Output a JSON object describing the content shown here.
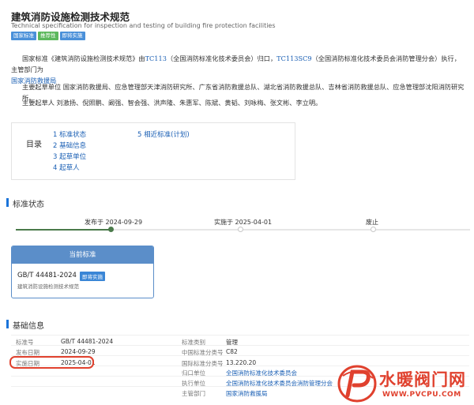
{
  "header": {
    "title": "建筑消防设施检测技术规范",
    "subtitle": "Technical specification for inspection and testing of building fire protection facilities",
    "badges": [
      {
        "label": "国家标准",
        "color": "#4a90d9"
      },
      {
        "label": "推荐性",
        "color": "#5cb85c"
      },
      {
        "label": "即将实施",
        "color": "#4a90d9"
      }
    ]
  },
  "intro": {
    "line1_prefix": "国家标准《建筑消防设施检测技术规范》由",
    "committee_code": "TC113",
    "line1_mid": "（全国消防标准化技术委员会）归口，",
    "sub_committee_code": "TC113SC9",
    "line1_suffix": "（全国消防标准化技术委员会消防管理分会）执行，主管部门为",
    "authority": "国家消防救援局",
    "line2": "主要起草单位 国家消防救援局、应急管理部天津消防研究所、广东省消防救援总队、湖北省消防救援总队、吉林省消防救援总队、应急管理部沈阳消防研究所。",
    "line3": "主要起草人 刘激扬、倪照鹏、阚强、智会强、洪声隆、朱惠军、陈斌、黄韬、刘咏梅、张文彬、李立明。"
  },
  "toc": {
    "title": "目录",
    "items": [
      "1  标准状态",
      "2  基础信息",
      "3  起草单位",
      "4  起草人",
      "5  相近标准(计划)"
    ]
  },
  "status": {
    "section_title": "标准状态",
    "timeline": [
      {
        "label": "发布于 2024-09-29",
        "done": true
      },
      {
        "label": "实施于 2025-04-01",
        "done": false
      },
      {
        "label": "废止",
        "done": false
      }
    ],
    "card": {
      "header": "当前标准",
      "code": "GB/T 44481-2024",
      "badge": "即将实施",
      "description": "建筑消防设施检测技术规范"
    }
  },
  "basic": {
    "section_title": "基础信息",
    "left": [
      {
        "label": "标准号",
        "value": "GB/T 44481-2024"
      },
      {
        "label": "发布日期",
        "value": "2024-09-29"
      },
      {
        "label": "实施日期",
        "value": "2025-04-01"
      }
    ],
    "right": [
      {
        "label": "标准类别",
        "value": "管理"
      },
      {
        "label": "中国标准分类号",
        "value": "C82"
      },
      {
        "label": "国际标准分类号",
        "value": "13.220.20"
      },
      {
        "label": "归口单位",
        "value": "全国消防标准化技术委员会"
      },
      {
        "label": "执行单位",
        "value": "全国消防标准化技术委员会消防管理分会"
      },
      {
        "label": "主管部门",
        "value": "国家消防救援局"
      }
    ]
  },
  "watermark": {
    "text": "水暖阀门网",
    "url": "WWW.PVCPU.COM",
    "accent_color": "#e0412e"
  }
}
